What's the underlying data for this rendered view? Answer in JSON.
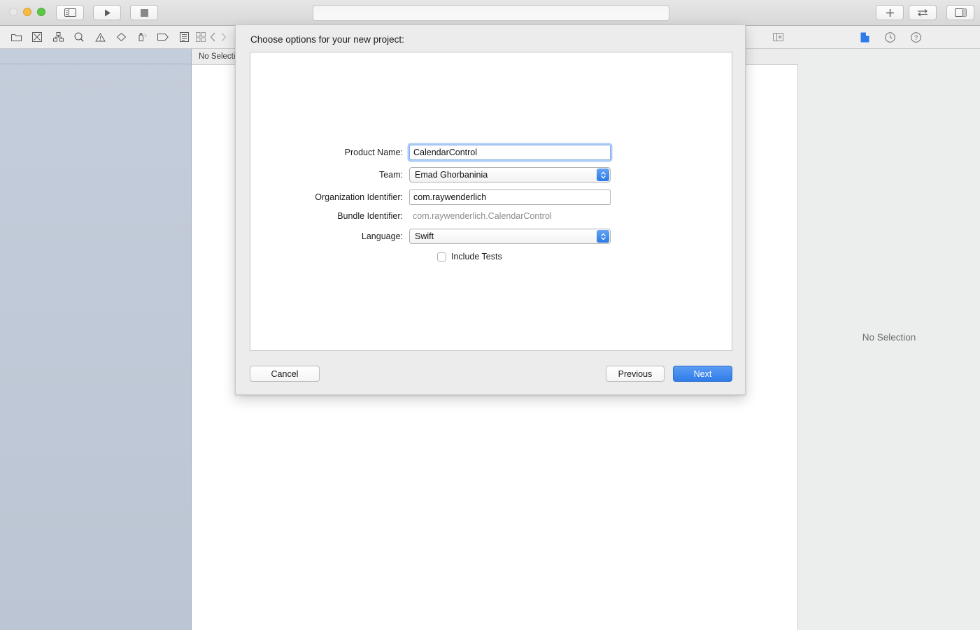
{
  "window": {
    "traffic_lights": [
      "close",
      "minimize",
      "maximize"
    ],
    "status_field_value": ""
  },
  "toolbar": {
    "left_buttons": [
      {
        "name": "navigator-toggle",
        "icon": "sidebar-left-icon"
      },
      {
        "name": "run-button",
        "icon": "play-icon"
      },
      {
        "name": "stop-button",
        "icon": "stop-icon"
      }
    ],
    "right_buttons": [
      {
        "name": "add-editor-button",
        "icon": "plus-icon"
      },
      {
        "name": "editor-mode-button",
        "icon": "swap-arrows-icon"
      },
      {
        "name": "inspector-toggle",
        "icon": "sidebar-right-icon"
      }
    ]
  },
  "navigator": {
    "tabs": [
      {
        "name": "project-navigator",
        "icon": "folder-icon"
      },
      {
        "name": "source-control-navigator",
        "icon": "x-box-icon"
      },
      {
        "name": "symbol-navigator",
        "icon": "hierarchy-icon"
      },
      {
        "name": "find-navigator",
        "icon": "search-icon"
      },
      {
        "name": "issue-navigator",
        "icon": "warning-triangle-icon"
      },
      {
        "name": "test-navigator",
        "icon": "diamond-icon"
      },
      {
        "name": "debug-navigator",
        "icon": "debug-spray-icon"
      },
      {
        "name": "breakpoint-navigator",
        "icon": "tag-icon"
      },
      {
        "name": "report-navigator",
        "icon": "report-icon"
      }
    ]
  },
  "jumpbar": {
    "grid_icon": "grid-icon",
    "back_icon": "chevron-left-icon",
    "label": "No Selection"
  },
  "inspector": {
    "pane_toggle_icon": "pane-add-icon",
    "tabs": [
      {
        "name": "file-inspector",
        "icon": "file-icon",
        "selected": true
      },
      {
        "name": "history-inspector",
        "icon": "clock-icon",
        "selected": false
      },
      {
        "name": "quick-help-inspector",
        "icon": "question-icon",
        "selected": false
      }
    ],
    "empty_label": "No Selection"
  },
  "dialog": {
    "title": "Choose options for your new project:",
    "fields": [
      {
        "name": "product-name",
        "label": "Product Name:",
        "type": "text",
        "value": "CalendarControl",
        "placeholder": "",
        "focused": true
      },
      {
        "name": "team",
        "label": "Team:",
        "type": "popup",
        "value": "Emad Ghorbaninia"
      },
      {
        "name": "organization-identifier",
        "label": "Organization Identifier:",
        "type": "text",
        "value": "com.raywenderlich",
        "placeholder": "",
        "focused": false
      },
      {
        "name": "bundle-identifier",
        "label": "Bundle Identifier:",
        "type": "static",
        "value": "com.raywenderlich.CalendarControl"
      },
      {
        "name": "language",
        "label": "Language:",
        "type": "popup",
        "value": "Swift"
      }
    ],
    "checkbox": {
      "name": "include-tests",
      "label": "Include Tests",
      "checked": false
    },
    "buttons": {
      "cancel": "Cancel",
      "previous": "Previous",
      "next": "Next"
    },
    "accent_color": "#2f7ce9"
  }
}
